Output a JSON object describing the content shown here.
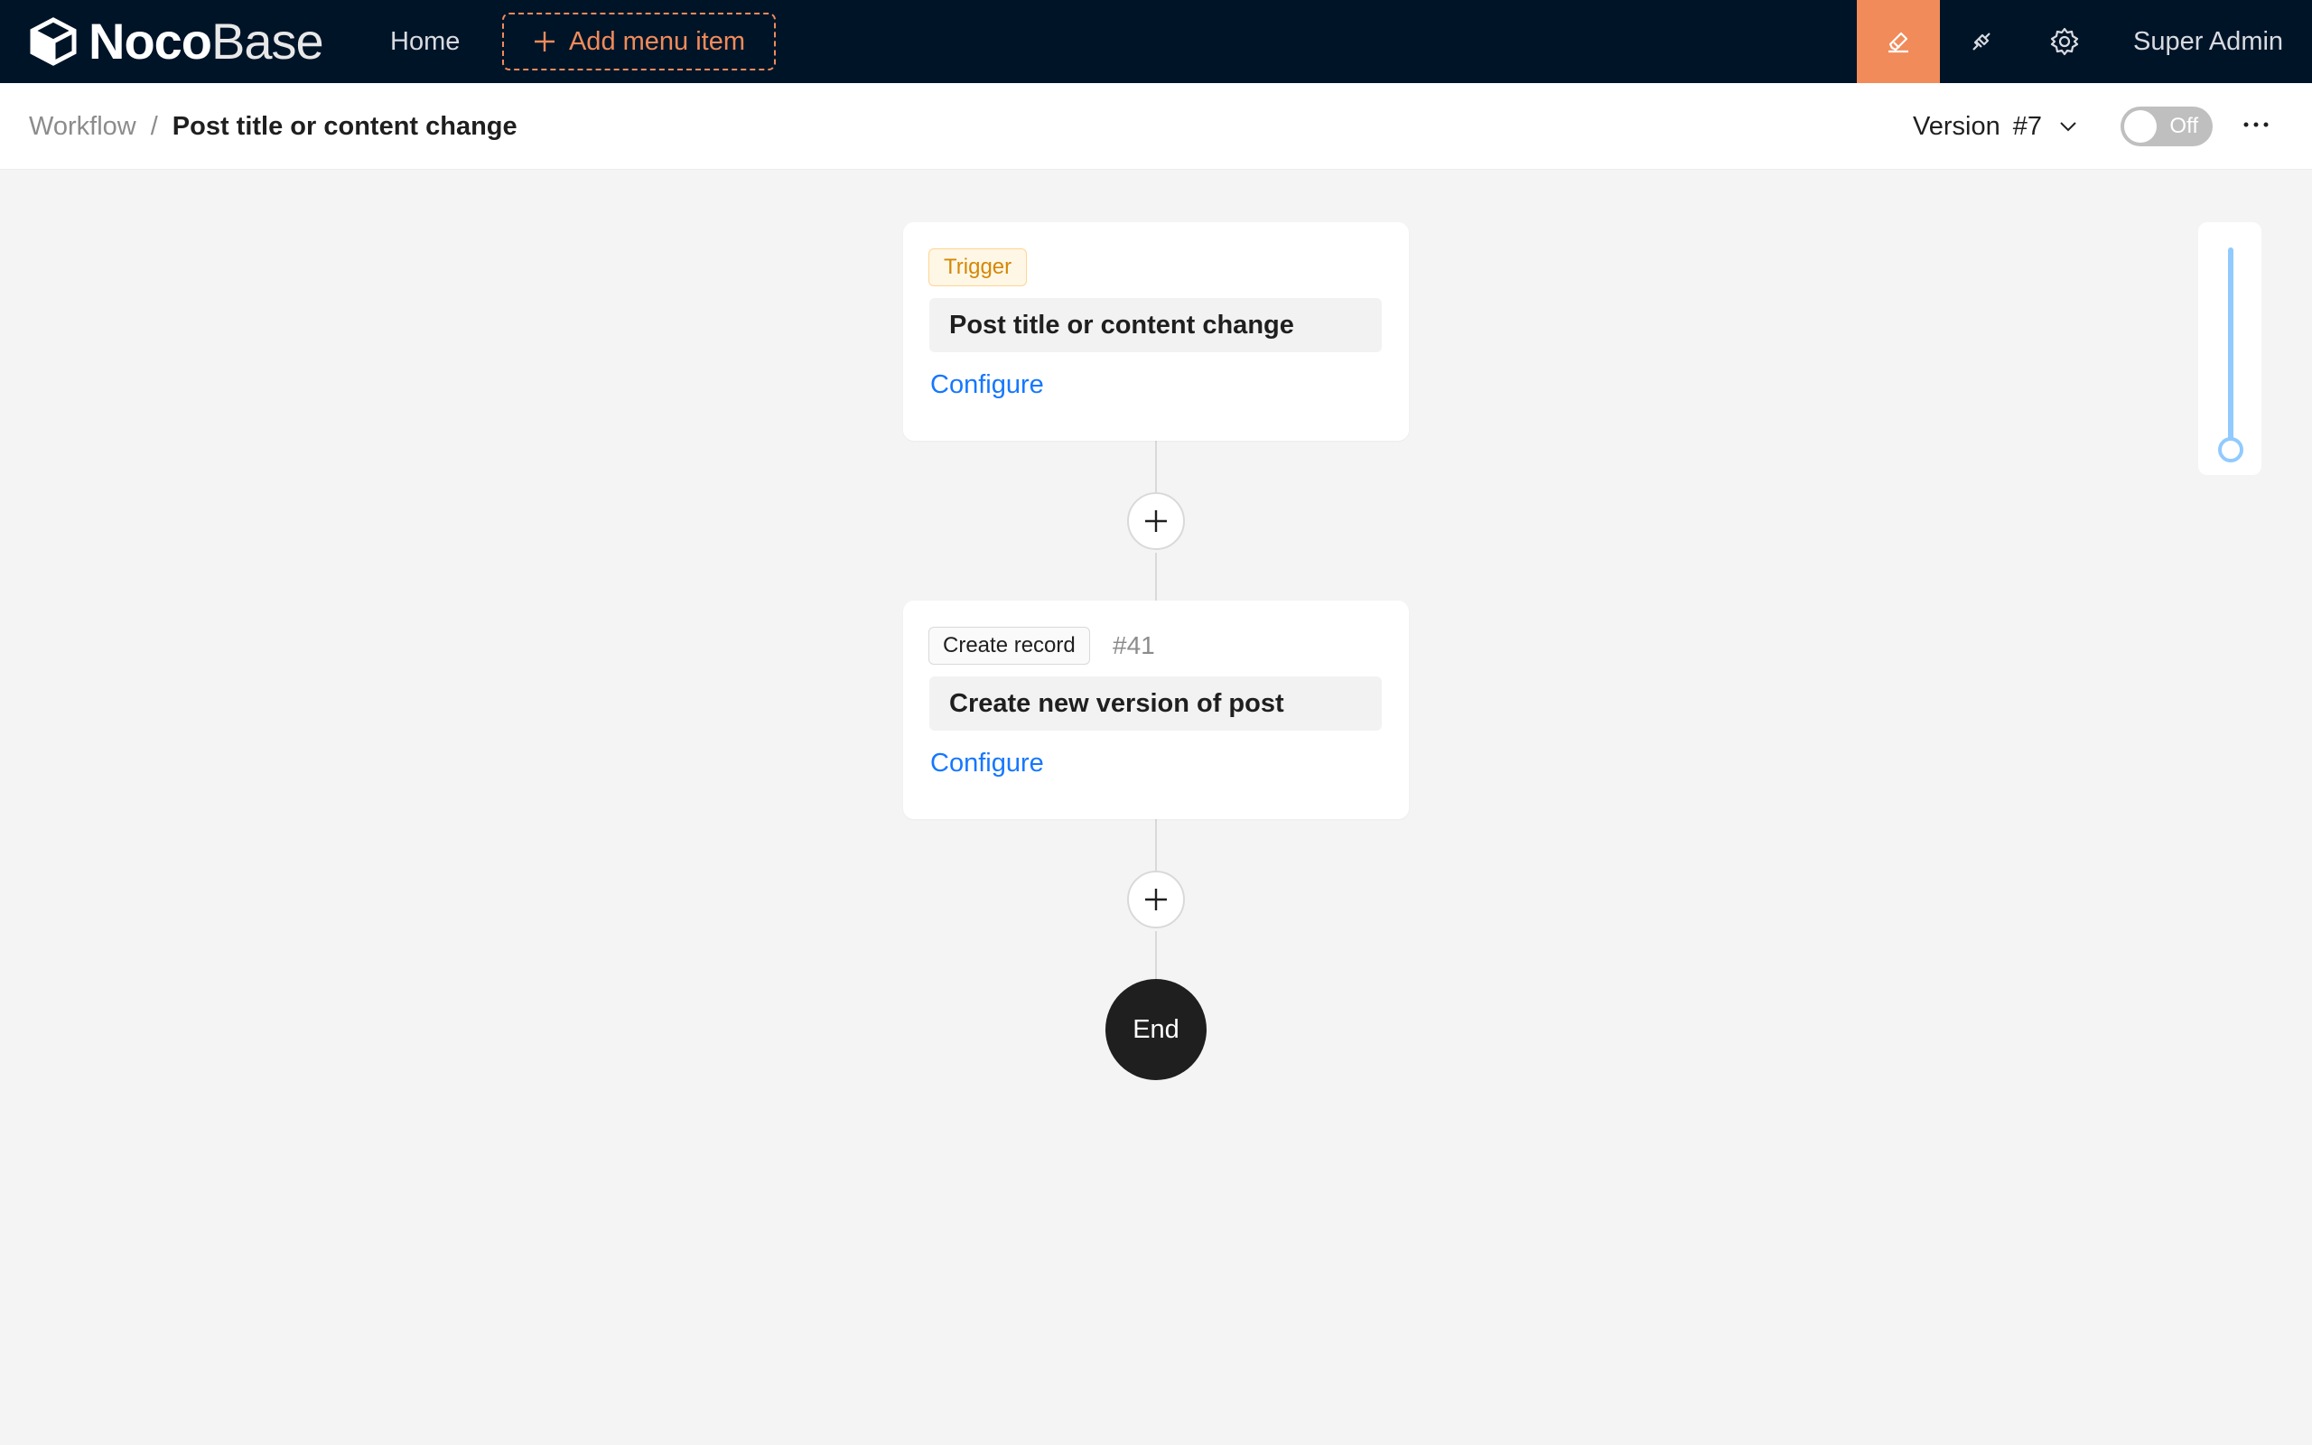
{
  "app": {
    "logo_bold": "Noco",
    "logo_light": "Base",
    "nav_home": "Home",
    "add_menu_item": "Add menu item",
    "user_name": "Super Admin"
  },
  "header": {
    "breadcrumb_parent": "Workflow",
    "breadcrumb_separator": "/",
    "breadcrumb_current": "Post title or content change",
    "version_label": "Version",
    "version_number": "#7",
    "toggle_label": "Off"
  },
  "workflow": {
    "trigger": {
      "tag": "Trigger",
      "title": "Post title or content change",
      "configure": "Configure"
    },
    "nodes": [
      {
        "tag": "Create record",
        "id": "#41",
        "title": "Create new version of post",
        "configure": "Configure"
      }
    ],
    "end_label": "End"
  },
  "colors": {
    "topbar_bg": "#001428",
    "accent": "#f18b5a",
    "link": "#1677ff",
    "trigger_tag": "#d48806"
  }
}
